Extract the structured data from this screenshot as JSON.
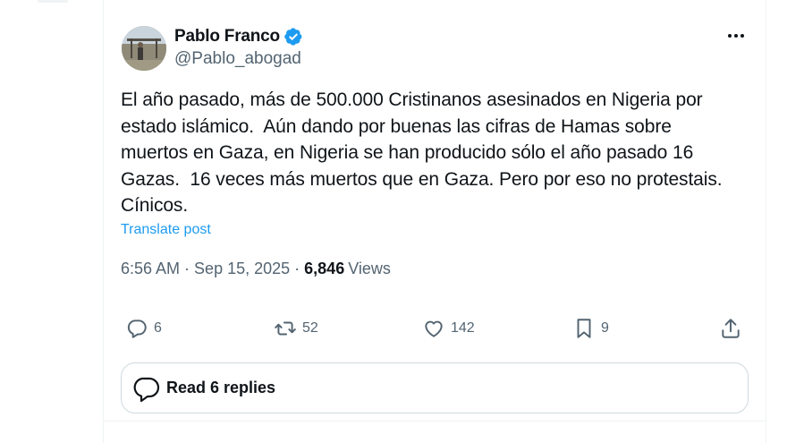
{
  "author": {
    "display_name": "Pablo Franco",
    "handle": "@Pablo_abogad",
    "verified": true,
    "avatar_icon": "avatar-photo"
  },
  "tweet": {
    "text": "El año pasado, más de 500.000 Cristinanos asesinados en Nigeria por\nestado islámico.  Aún dando por buenas las cifras de Hamas sobre\nmuertos en Gaza, en Nigeria se han producido sólo el año pasado 16\nGazas.  16 veces más muertos que en Gaza. Pero por eso no protestais.\nCínicos.",
    "translate_label": "Translate post"
  },
  "meta": {
    "time": "6:56 AM",
    "separator": "·",
    "date": "Sep 15, 2025",
    "views_count": "6,846",
    "views_label": "Views"
  },
  "actions": {
    "replies": "6",
    "reposts": "52",
    "likes": "142",
    "bookmarks": "9"
  },
  "read_replies": {
    "label": "Read 6 replies"
  },
  "colors": {
    "text": "#0f1419",
    "secondary": "#536471",
    "accent": "#1d9bf0",
    "border": "#cfd9de"
  }
}
